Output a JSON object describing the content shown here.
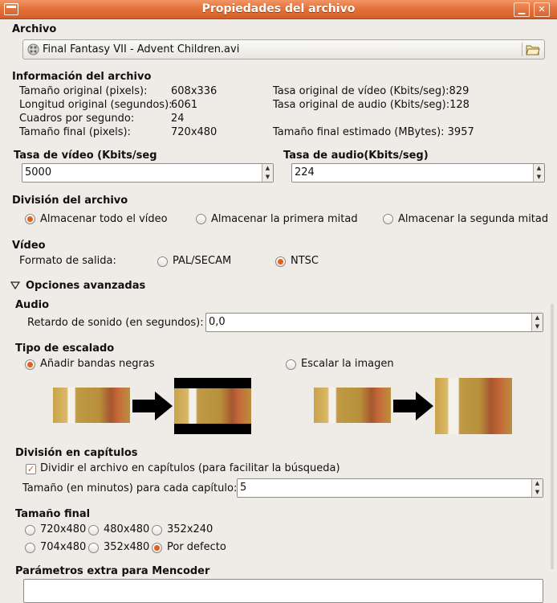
{
  "window": {
    "title": "Propiedades del archivo",
    "minimize_glyph": "▁",
    "close_glyph": "✕"
  },
  "archivo": {
    "heading": "Archivo",
    "filename": "Final Fantasy VII - Advent Children.avi",
    "folder_icon": "folder-open-icon"
  },
  "info": {
    "heading": "Información del archivo",
    "rows": [
      {
        "label": "Tamaño original (pixels):",
        "value": "608x336"
      },
      {
        "label": "Longitud original (segundos):",
        "value": "6061"
      },
      {
        "label": "Cuadros por segundo:",
        "value": "24"
      },
      {
        "label": "Tamaño final (pixels):",
        "value": "720x480"
      }
    ],
    "right_rows": [
      "Tasa original de vídeo (Kbits/seg):829",
      "Tasa original de audio (Kbits/seg):128",
      "Tamaño final estimado (MBytes): 3957"
    ]
  },
  "video_rate": {
    "label": "Tasa de vídeo (Kbits/seg",
    "value": "5000"
  },
  "audio_rate": {
    "label": "Tasa de audio(Kbits/seg)",
    "value": "224"
  },
  "division": {
    "heading": "División del archivo",
    "options": [
      "Almacenar todo el vídeo",
      "Almacenar la primera mitad",
      "Almacenar la segunda mitad"
    ],
    "selected": 0
  },
  "video": {
    "heading": "Vídeo",
    "format_label": "Formato de salida:",
    "options": [
      "PAL/SECAM",
      "NTSC"
    ],
    "selected": 1
  },
  "advanced": {
    "heading": "Opciones avanzadas"
  },
  "audio": {
    "heading": "Audio",
    "delay_label": "Retardo de sonido (en segundos):",
    "delay_value": "0,0"
  },
  "scaling": {
    "heading": "Tipo de escalado",
    "options": [
      "Añadir bandas negras",
      "Escalar la imagen"
    ],
    "selected": 0
  },
  "chapters": {
    "heading": "División en capítulos",
    "checkbox_label": "Dividir el archivo en capítulos (para facilitar la búsqueda)",
    "checked": true,
    "size_label": "Tamaño (en minutos) para cada capítulo:",
    "size_value": "5"
  },
  "final_size": {
    "heading": "Tamaño final",
    "options": [
      "720x480",
      "480x480",
      "352x240",
      "704x480",
      "352x480",
      "Por defecto"
    ],
    "selected": 5
  },
  "mencoder": {
    "heading": "Parámetros extra para Mencoder",
    "value": ""
  },
  "colors": {
    "accent": "#e0611f",
    "titlebar": "#e4723b",
    "background": "#efebe7"
  }
}
